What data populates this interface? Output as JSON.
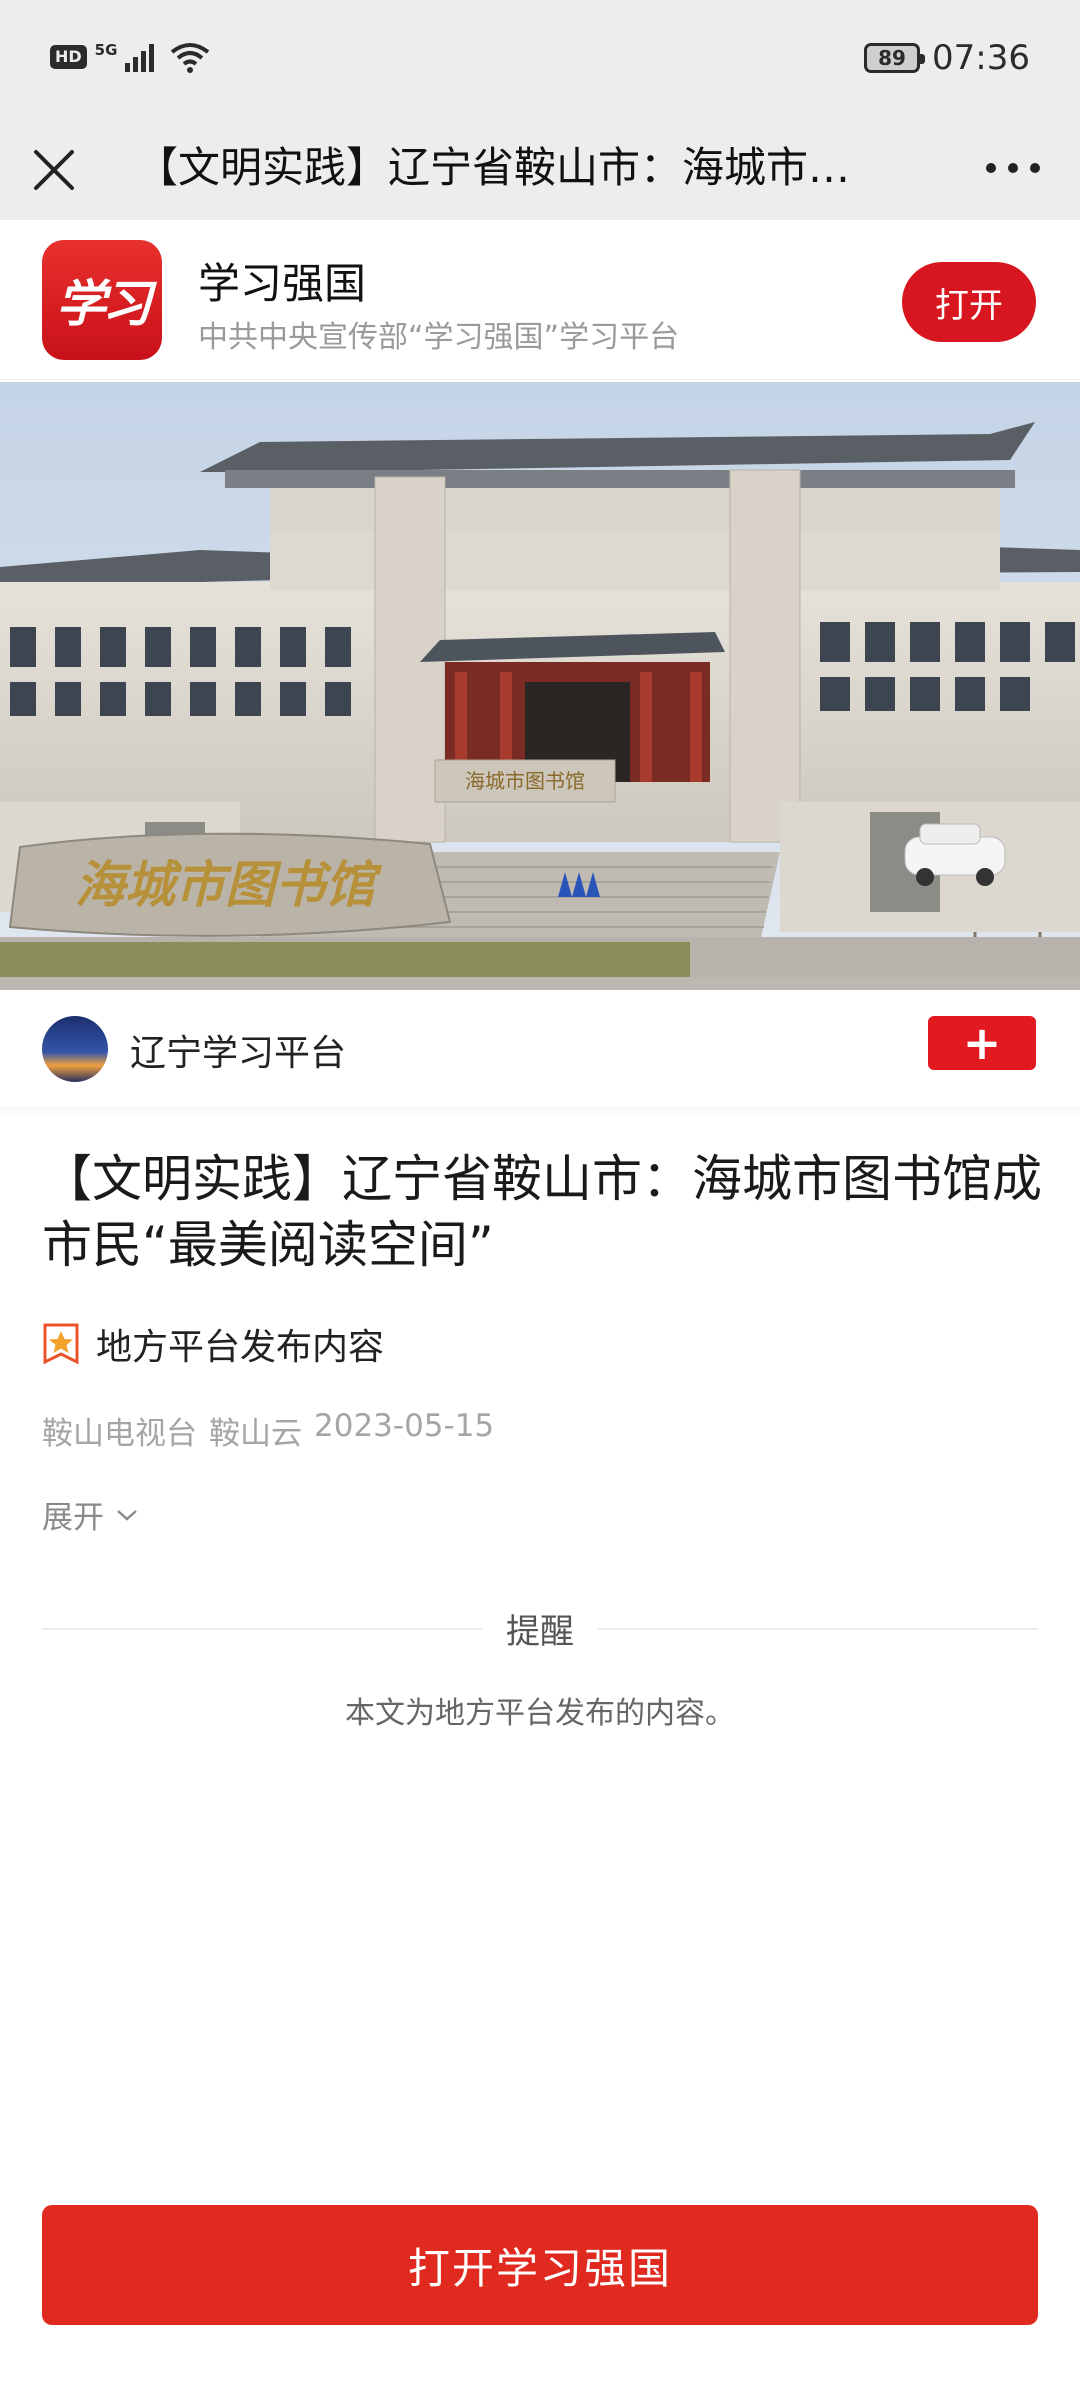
{
  "status_bar": {
    "hd": "HD",
    "network": "5G",
    "battery": "89",
    "time": "07:36"
  },
  "title_bar": {
    "title": "【文明实践】辽宁省鞍山市：海城市…"
  },
  "app_banner": {
    "logo_text": "学习",
    "name": "学习强国",
    "description": "中共中央宣传部“学习强国”学习平台",
    "open_label": "打开"
  },
  "hero_image": {
    "stone_inscription": "海城市图书馆",
    "entrance_sign": "海城市图书馆"
  },
  "source": {
    "name": "辽宁学习平台",
    "follow_label": "+"
  },
  "article": {
    "title": "【文明实践】辽宁省鞍山市：海城市图书馆成市民“最美阅读空间”",
    "badge": "地方平台发布内容",
    "meta": [
      "鞍山电视台",
      "鞍山云",
      "2023-05-15"
    ],
    "expand_label": "展开"
  },
  "notice": {
    "title": "提醒",
    "body": "本文为地方平台发布的内容。"
  },
  "bottom_button": {
    "label": "打开学习强国"
  },
  "colors": {
    "brand_red": "#d8161f",
    "button_red": "#e02a20",
    "header_gray": "#ededed"
  }
}
